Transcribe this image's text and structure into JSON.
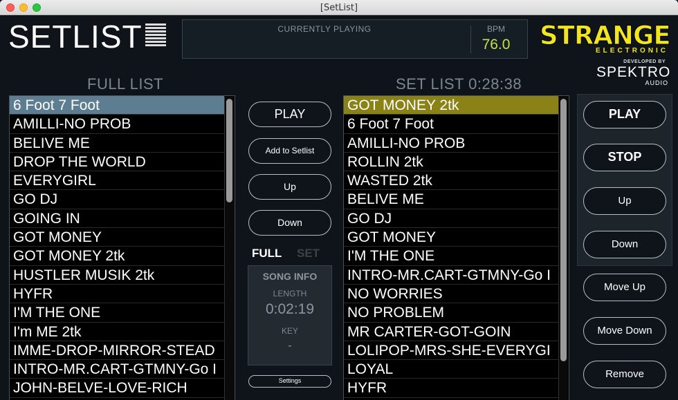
{
  "window": {
    "title": "[SetList]"
  },
  "app": {
    "logo": "SETLIST"
  },
  "now_playing": {
    "label": "CURRENTLY PLAYING",
    "bpm_label": "BPM",
    "bpm_value": "76.0"
  },
  "brand": {
    "name": "STRANGE",
    "sub": "ELECTRONIC",
    "developed_by": "DEVELOPED BY",
    "dev_name": "SPEKTRO",
    "dev_sub": "AUDIO"
  },
  "full_list": {
    "header": "FULL LIST",
    "items": [
      "6 Foot 7 Foot",
      "AMILLI-NO PROB",
      "BELIVE ME",
      "DROP THE WORLD",
      "EVERYGIRL",
      "GO DJ",
      "GOING IN",
      "GOT MONEY",
      "GOT MONEY 2tk",
      "HUSTLER MUSIK  2tk",
      "HYFR",
      "I'M THE ONE",
      "I'm ME 2tk",
      "IMME-DROP-MIRROR-STEAD",
      "INTRO-MR.CART-GTMNY-Go I",
      "JOHN-BELVE-LOVE-RICH"
    ],
    "selected_index": 0
  },
  "set_list": {
    "header": "SET LIST 0:28:38",
    "items": [
      "GOT MONEY 2tk",
      "6 Foot 7 Foot",
      "AMILLI-NO PROB",
      "ROLLIN 2tk",
      "WASTED 2tk",
      "BELIVE ME",
      "GO DJ",
      "GOT MONEY",
      "I'M THE ONE",
      "INTRO-MR.CART-GTMNY-Go I",
      "NO WORRIES",
      "NO PROBLEM",
      "MR CARTER-GOT-GOIN",
      "LOLIPOP-MRS-SHE-EVERYGI",
      "LOYAL",
      "HYFR"
    ],
    "selected_index": 0
  },
  "middle": {
    "play": "PLAY",
    "add": "Add to Setlist",
    "up": "Up",
    "down": "Down",
    "tab_full": "FULL",
    "tab_set": "SET",
    "song_info": {
      "title": "SONG INFO",
      "length_label": "LENGTH",
      "length": "0:02:19",
      "key_label": "KEY",
      "key": "-"
    },
    "settings": "Settings"
  },
  "right": {
    "play": "PLAY",
    "stop": "STOP",
    "up": "Up",
    "down": "Down",
    "move_up": "Move Up",
    "move_down": "Move Down",
    "remove": "Remove"
  }
}
